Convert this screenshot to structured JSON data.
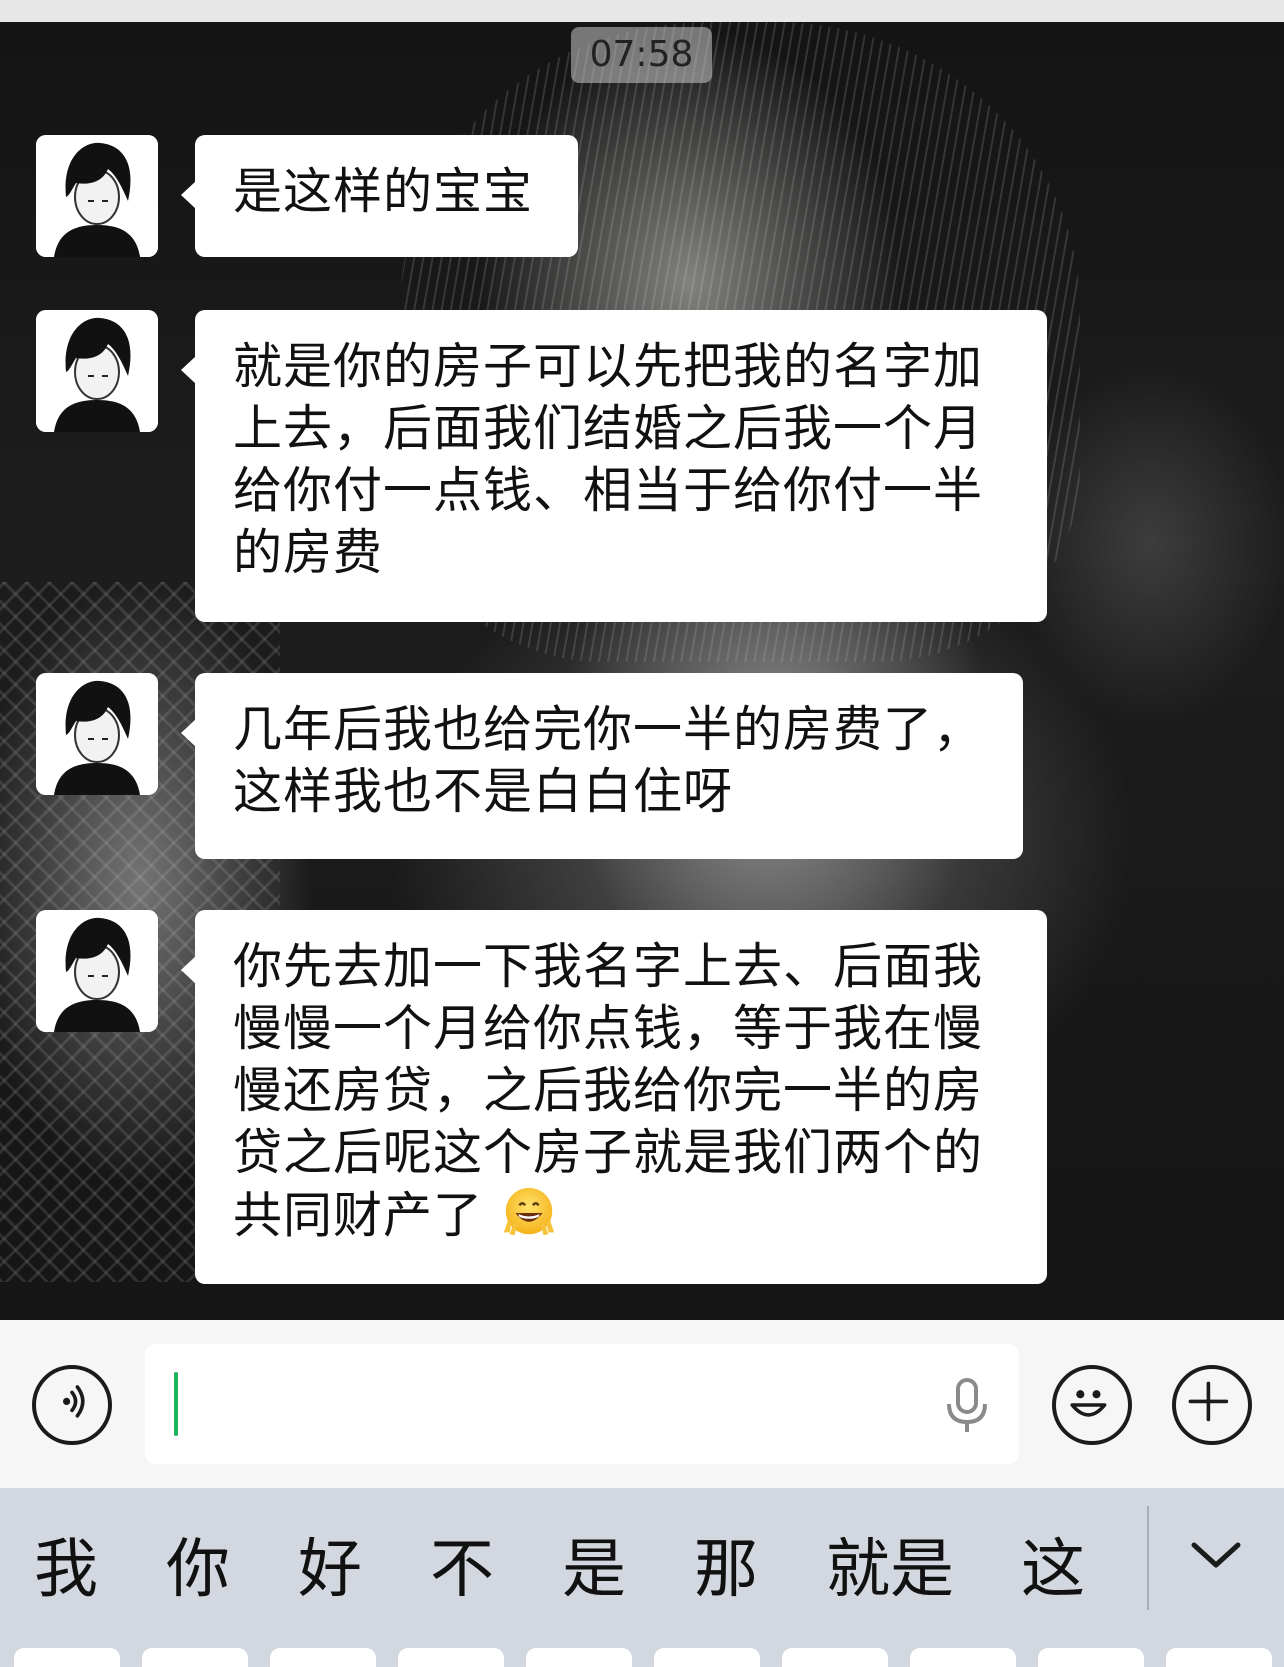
{
  "status": {
    "time": "07:58"
  },
  "messages": [
    {
      "text": "是这样的宝宝"
    },
    {
      "lines": [
        "就是你的房子可以先把我的名字加",
        "上去，后面我们结婚之后我一个月",
        "给你付一点钱、相当于给你付一半",
        "的房费"
      ]
    },
    {
      "lines": [
        "几年后我也给完你一半的房费了，",
        "这样我也不是白白住呀"
      ]
    },
    {
      "lines": [
        "你先去加一下我名字上去、后面我",
        "慢慢一个月给你点钱，等于我在慢",
        "慢还房贷，之后我给你完一半的房",
        "贷之后呢这个房子就是我们两个的",
        "共同财产了"
      ],
      "emoji": "victory-grin-emoji"
    }
  ],
  "input": {
    "value": ""
  },
  "suggestions": [
    "我",
    "你",
    "好",
    "不",
    "是",
    "那",
    "就是",
    "这"
  ],
  "icons": {
    "voice": "voice-icon",
    "mic": "microphone-icon",
    "emoji": "emoji-icon",
    "plus": "plus-icon",
    "collapse": "chevron-down-icon"
  },
  "colors": {
    "cursor": "#1bb55c",
    "bubble": "#ffffff",
    "suggestion_bar": "#d3d7df"
  }
}
